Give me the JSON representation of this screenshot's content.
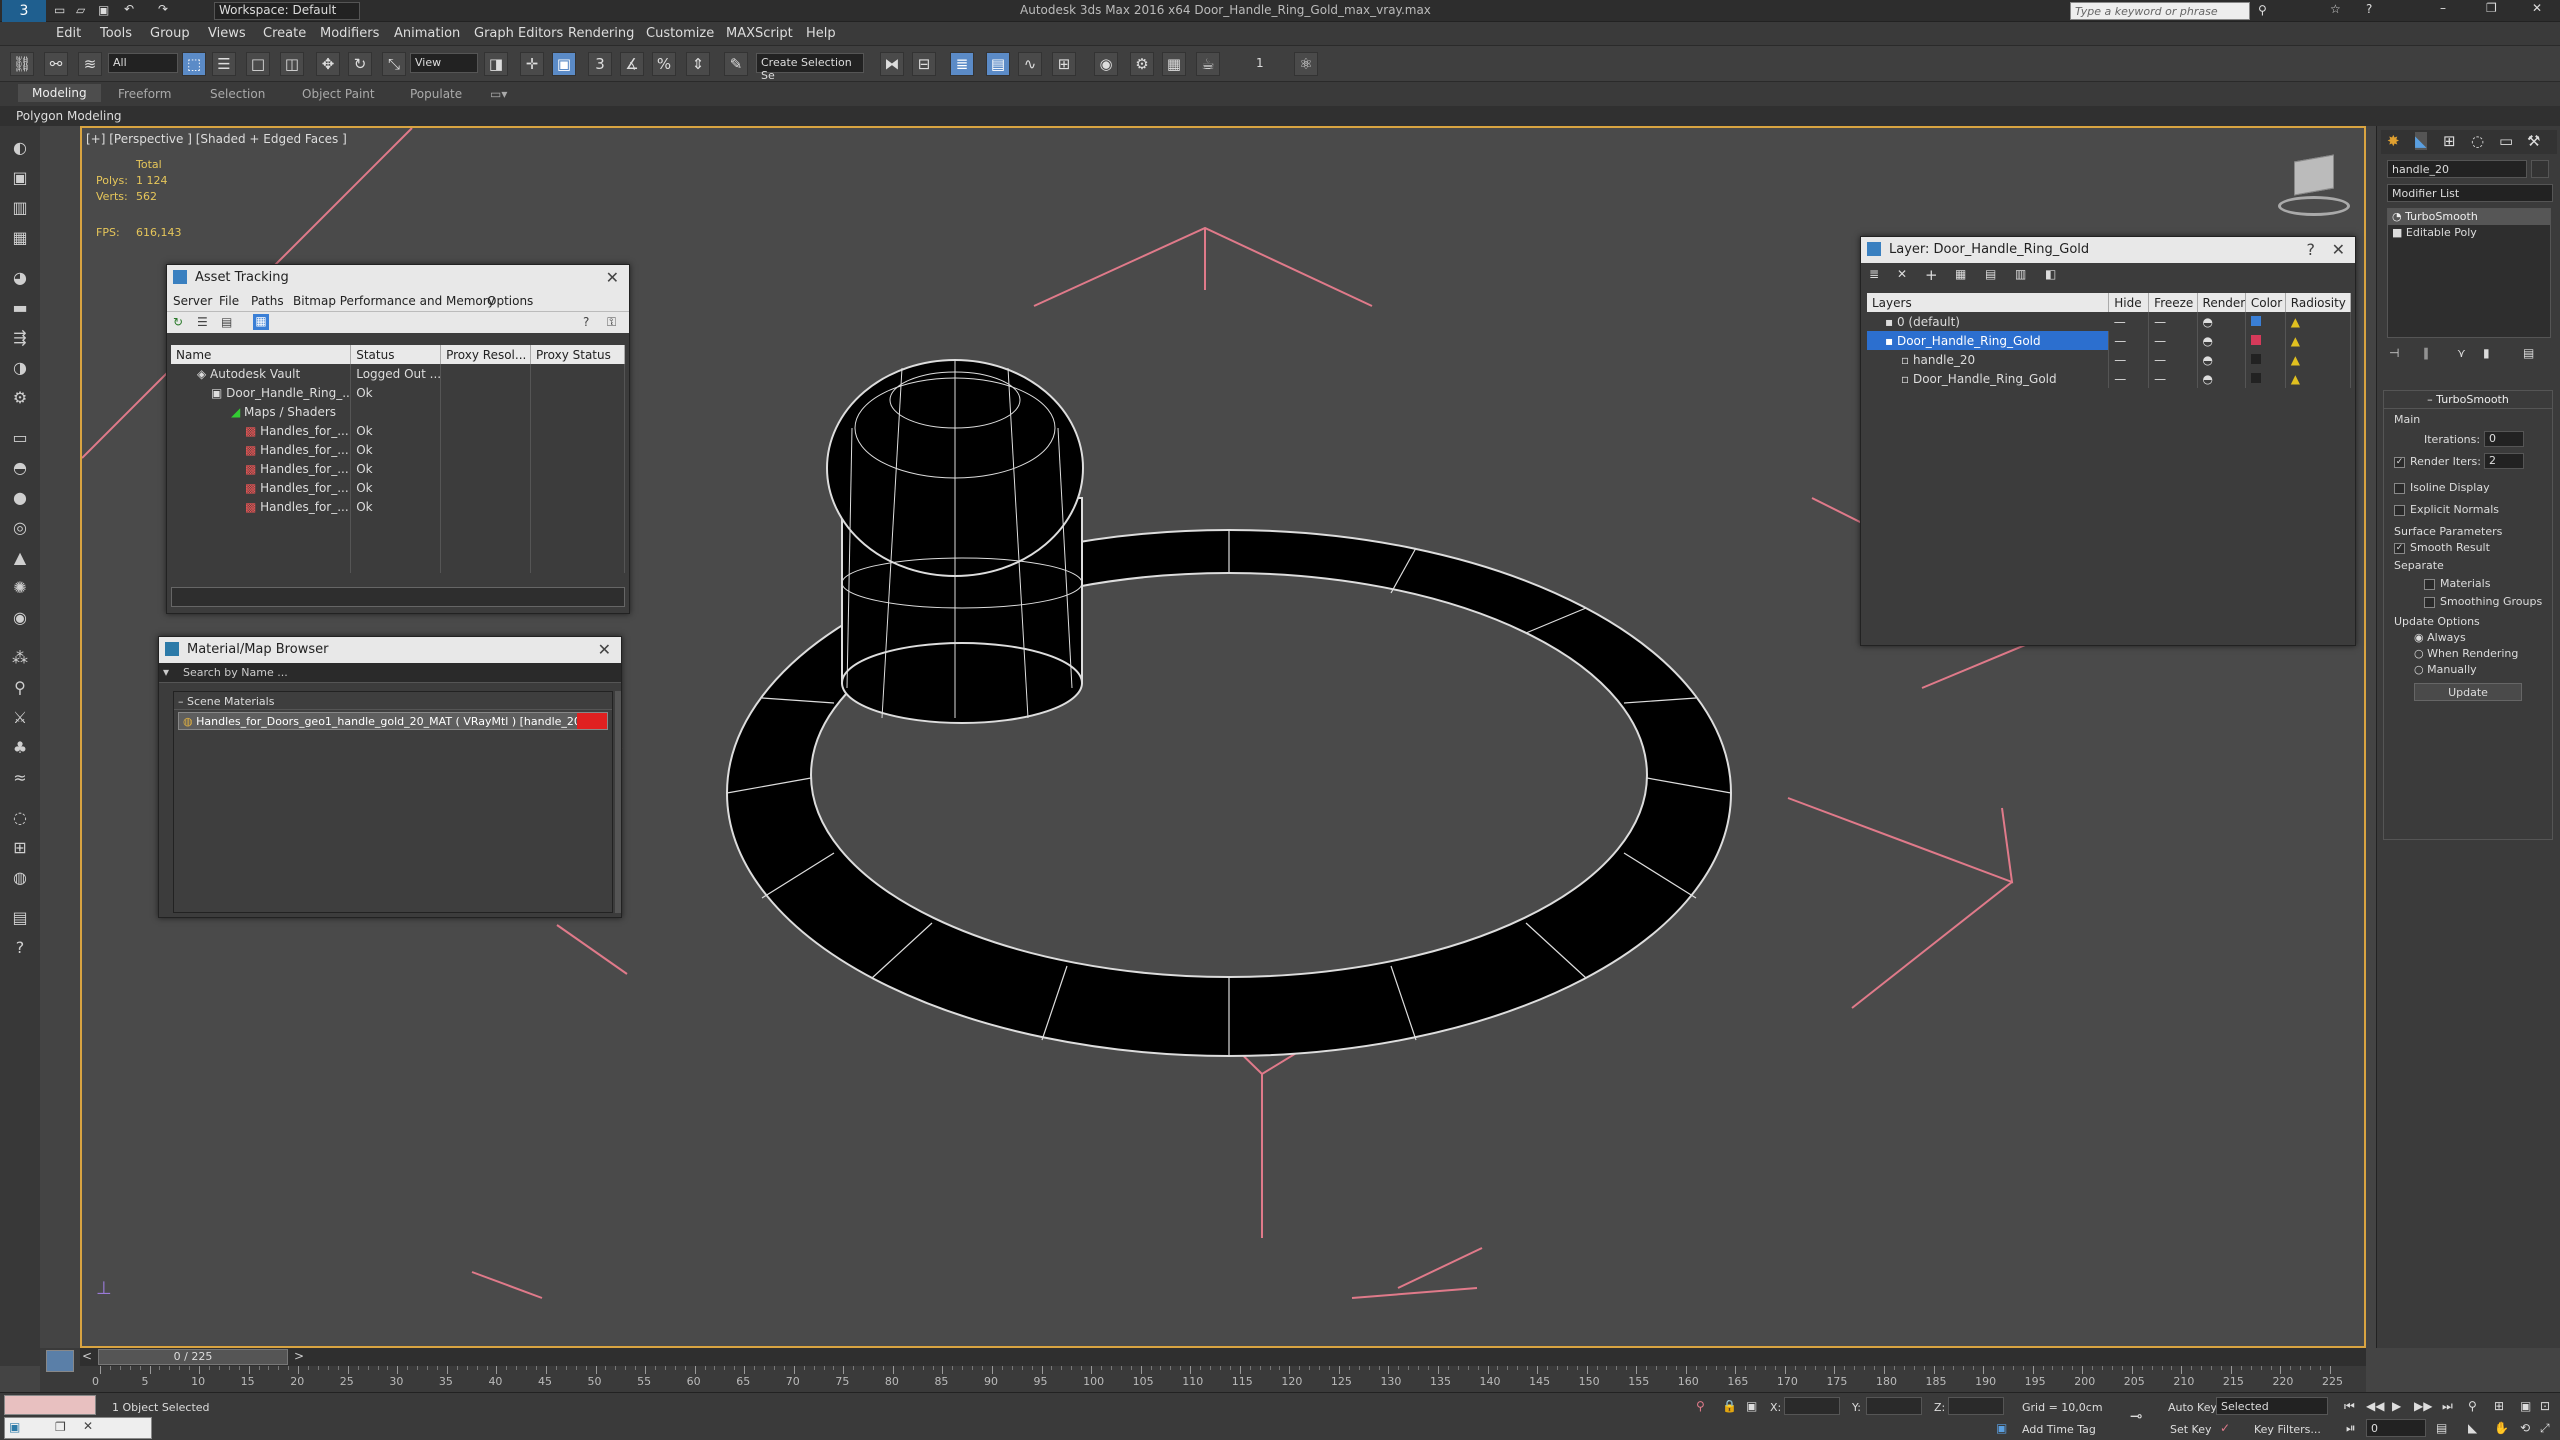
{
  "titlebar": {
    "title": "Autodesk 3ds Max 2016 x64    Door_Handle_Ring_Gold_max_vray.max",
    "workspace": "Workspace: Default",
    "search_placeholder": "Type a keyword or phrase"
  },
  "menu": [
    "Edit",
    "Tools",
    "Group",
    "Views",
    "Create",
    "Modifiers",
    "Animation",
    "Graph Editors",
    "Rendering",
    "Customize",
    "MAXScript",
    "Help"
  ],
  "toolbar": {
    "filter": "All",
    "refcoord": "View",
    "named_selection": "Create Selection Se",
    "spinner_value": "1"
  },
  "ribbon": {
    "tabs": [
      "Modeling",
      "Freeform",
      "Selection",
      "Object Paint",
      "Populate"
    ],
    "sub": "Polygon Modeling"
  },
  "viewport": {
    "label": "[+] [Perspective ] [Shaded + Edged Faces ]",
    "stats": {
      "total": "Total",
      "polys_label": "Polys:",
      "polys": "1 124",
      "verts_label": "Verts:",
      "verts": "562",
      "fps_label": "FPS:",
      "fps": "616,143"
    }
  },
  "asset_tracking": {
    "title": "Asset Tracking",
    "menu": [
      "Server",
      "File",
      "Paths",
      "Bitmap Performance and Memory",
      "Options"
    ],
    "columns": [
      "Name",
      "Status",
      "Proxy Resol...",
      "Proxy Status"
    ],
    "rows": [
      {
        "name": "Autodesk Vault",
        "status": "Logged Out ..."
      },
      {
        "name": "Door_Handle_Ring_...",
        "status": "Ok"
      },
      {
        "name": "Maps / Shaders",
        "status": ""
      },
      {
        "name": "Handles_for_...",
        "status": "Ok"
      },
      {
        "name": "Handles_for_...",
        "status": "Ok"
      },
      {
        "name": "Handles_for_...",
        "status": "Ok"
      },
      {
        "name": "Handles_for_...",
        "status": "Ok"
      },
      {
        "name": "Handles_for_...",
        "status": "Ok"
      }
    ]
  },
  "material_browser": {
    "title": "Material/Map Browser",
    "search_placeholder": "Search by Name ...",
    "group": "Scene Materials",
    "item": "Handles_for_Doors_geo1_handle_gold_20_MAT ( VRayMtl ) [handle_20]"
  },
  "layer_manager": {
    "title": "Layer: Door_Handle_Ring_Gold",
    "columns": [
      "Layers",
      "Hide",
      "Freeze",
      "Render",
      "Color",
      "Radiosity"
    ],
    "rows": [
      {
        "name": "0 (default)",
        "color": "#3a7fd6"
      },
      {
        "name": "Door_Handle_Ring_Gold",
        "color": "#d63a5a"
      },
      {
        "name": "handle_20",
        "color": "#222222"
      },
      {
        "name": "Door_Handle_Ring_Gold",
        "color": "#222222"
      }
    ]
  },
  "command_panel": {
    "object_name": "handle_20",
    "modifier_list": "Modifier List",
    "stack": [
      "TurboSmooth",
      "Editable Poly"
    ],
    "rollout_title": "TurboSmooth",
    "main": "Main",
    "iterations_label": "Iterations:",
    "iterations": "0",
    "render_iters_label": "Render Iters:",
    "render_iters": "2",
    "isoline": "Isoline Display",
    "explicit": "Explicit Normals",
    "surface": "Surface Parameters",
    "smooth_result": "Smooth Result",
    "separate": "Separate",
    "materials": "Materials",
    "smoothing_groups": "Smoothing Groups",
    "update_options": "Update Options",
    "always": "Always",
    "when_rendering": "When Rendering",
    "manually": "Manually",
    "update_btn": "Update"
  },
  "timeline": {
    "frame": "0 / 225",
    "ticks": [
      "0",
      "5",
      "10",
      "15",
      "20",
      "25",
      "30",
      "35",
      "40",
      "45",
      "50",
      "55",
      "60",
      "65",
      "70",
      "75",
      "80",
      "85",
      "90",
      "95",
      "100",
      "105",
      "110",
      "115",
      "120",
      "125",
      "130",
      "135",
      "140",
      "145",
      "150",
      "155",
      "160",
      "165",
      "170",
      "175",
      "180",
      "185",
      "190",
      "195",
      "200",
      "205",
      "210",
      "215",
      "220",
      "225"
    ]
  },
  "status": {
    "selected": "1 Object Selected",
    "x_label": "X:",
    "y_label": "Y:",
    "z_label": "Z:",
    "grid": "Grid = 10,0cm",
    "add_time_tag": "Add Time Tag",
    "auto_key": "Auto Key",
    "set_key": "Set Key",
    "selected_dd": "Selected",
    "key_filters": "Key Filters...",
    "frame_field": "0"
  }
}
